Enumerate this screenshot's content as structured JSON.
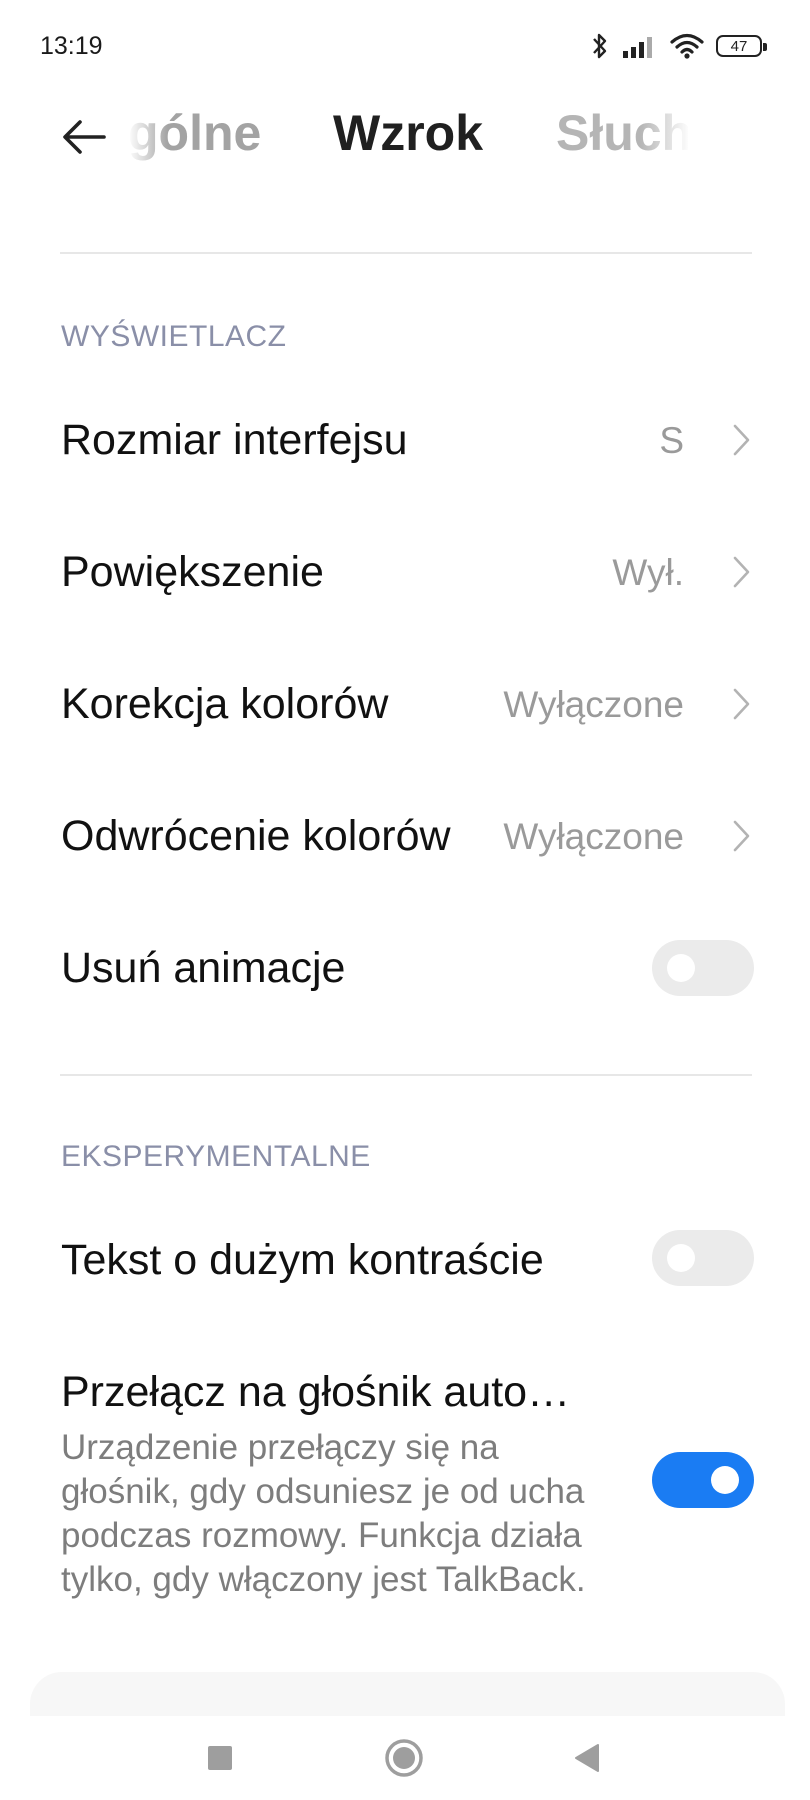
{
  "status_bar": {
    "time": "13:19",
    "battery": "47",
    "icons": [
      "bluetooth-icon",
      "signal-icon",
      "wifi-icon",
      "battery-icon"
    ]
  },
  "header": {
    "tabs": [
      {
        "label": "gólne",
        "state": "inactive"
      },
      {
        "label": "Wzrok",
        "state": "active"
      },
      {
        "label": "Słuch",
        "state": "inactive"
      }
    ]
  },
  "sections": {
    "display": {
      "title": "WYŚWIETLACZ",
      "rows": [
        {
          "label": "Rozmiar interfejsu",
          "value": "S"
        },
        {
          "label": "Powiększenie",
          "value": "Wył."
        },
        {
          "label": "Korekcja kolorów",
          "value": "Wyłączone"
        },
        {
          "label": "Odwrócenie kolorów",
          "value": "Wyłączone"
        },
        {
          "label": "Usuń animacje",
          "toggle": false
        }
      ]
    },
    "experimental": {
      "title": "EKSPERYMENTALNE",
      "rows": [
        {
          "label": "Tekst o dużym kontraście",
          "toggle": false
        },
        {
          "label": "Przełącz na głośnik auto…",
          "description_lines": [
            "Urządzenie przełączy się na",
            "głośnik, gdy odsuniesz je od ucha",
            "podczas rozmowy. Funkcja działa",
            "tylko, gdy włączony jest TalkBack."
          ],
          "toggle": true
        }
      ]
    }
  },
  "colors": {
    "accent": "#1a7cf3",
    "section_title": "#8a8fa8",
    "value_text": "#9a9a9a",
    "toggle_off": "#ebebeb"
  }
}
